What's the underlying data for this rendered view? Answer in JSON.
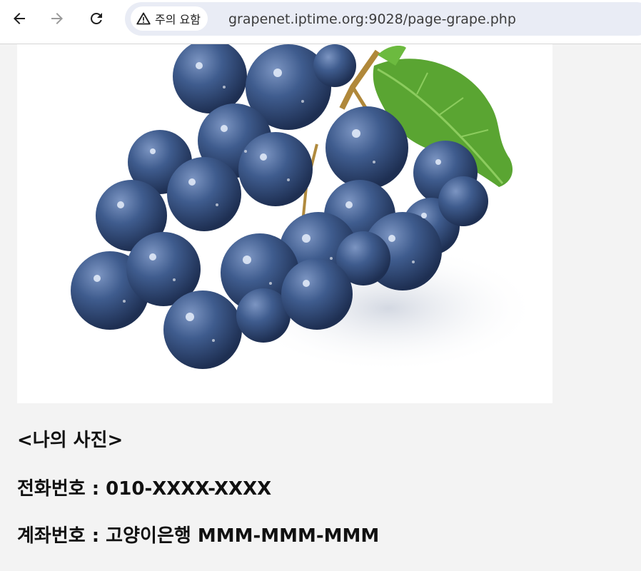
{
  "browser": {
    "back_icon": "arrow-left-icon",
    "forward_icon": "arrow-right-icon",
    "reload_icon": "reload-icon",
    "security_chip": {
      "icon": "warning-triangle-icon",
      "label": "주의 요함"
    },
    "url": "grapenet.iptime.org:9028/page-grape.php"
  },
  "page": {
    "image": {
      "subject": "grapes-photo",
      "colors": {
        "grape": "#3b5584",
        "leaf": "#5aa532",
        "background": "#ffffff"
      }
    },
    "caption": "<나의 사진>",
    "phone_line": "전화번호 : 010-XXXX-XXXX",
    "account_line": "계좌번호 : 고양이은행 MMM-MMM-MMM"
  }
}
